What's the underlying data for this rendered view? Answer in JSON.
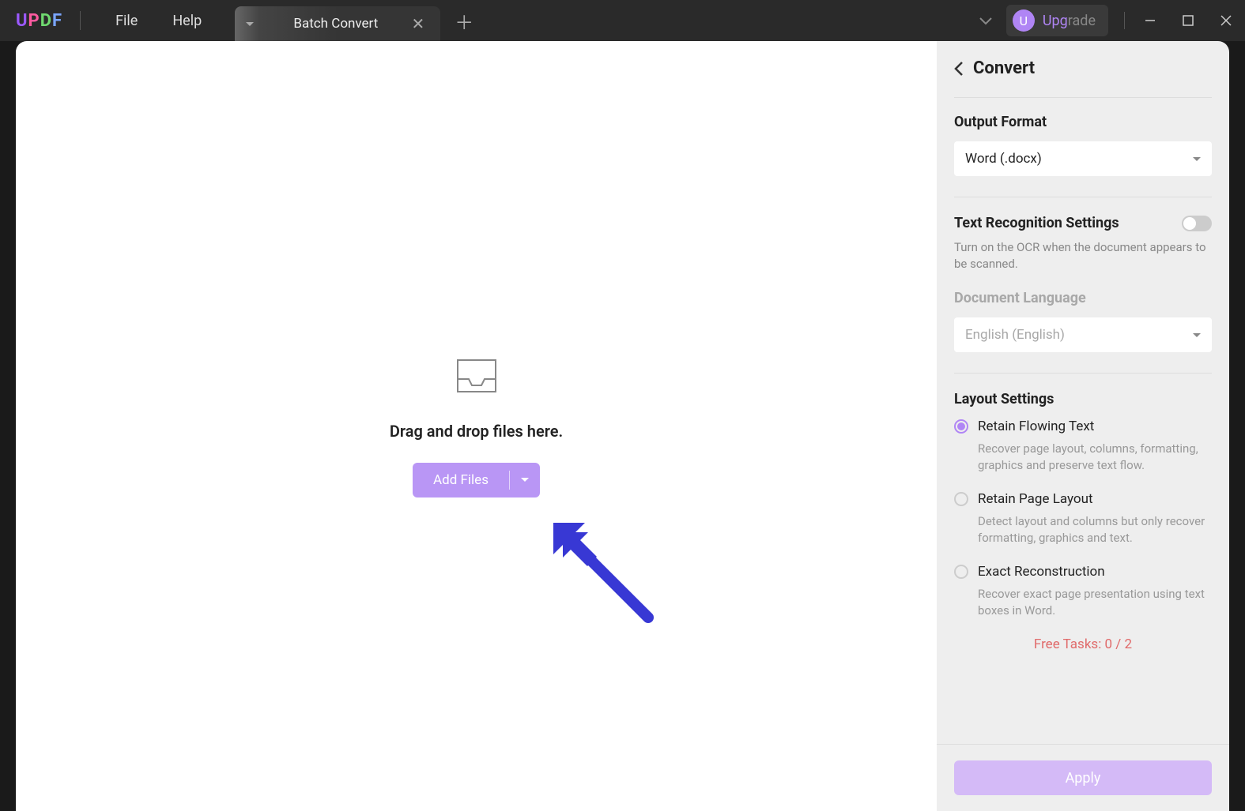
{
  "app": {
    "logo": "UPDF"
  },
  "menu": {
    "file": "File",
    "help": "Help"
  },
  "tabs": {
    "active": "Batch Convert"
  },
  "upgrade": {
    "avatar_letter": "U",
    "label": "Upgrade"
  },
  "main": {
    "drop_text": "Drag and drop files here.",
    "add_files": "Add Files"
  },
  "panel": {
    "title": "Convert",
    "output_format": {
      "label": "Output Format",
      "value": "Word (.docx)"
    },
    "ocr": {
      "label": "Text Recognition Settings",
      "desc": "Turn on the OCR when the document appears to be scanned.",
      "enabled": false
    },
    "doc_lang": {
      "label": "Document Language",
      "value": "English (English)"
    },
    "layout": {
      "label": "Layout Settings",
      "options": [
        {
          "label": "Retain Flowing Text",
          "desc": "Recover page layout, columns, formatting, graphics and preserve text flow.",
          "selected": true
        },
        {
          "label": "Retain Page Layout",
          "desc": "Detect layout and columns but only recover formatting, graphics and text.",
          "selected": false
        },
        {
          "label": "Exact Reconstruction",
          "desc": "Recover exact page presentation using text boxes in Word.",
          "selected": false
        }
      ]
    },
    "free_tasks": "Free Tasks: 0 / 2",
    "apply": "Apply"
  }
}
